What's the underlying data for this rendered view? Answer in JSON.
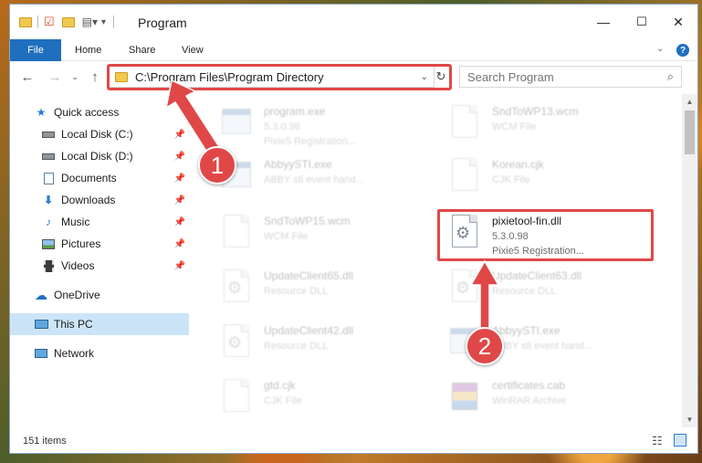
{
  "window": {
    "title": "Program",
    "controls": {
      "minimize": "—",
      "maximize": "☐",
      "close": "✕"
    }
  },
  "ribbon": {
    "tabs": [
      {
        "label": "File"
      },
      {
        "label": "Home"
      },
      {
        "label": "Share"
      },
      {
        "label": "View"
      }
    ],
    "help": "?"
  },
  "address_bar": {
    "path": "C:\\Program Files\\Program Directory",
    "search_placeholder": "Search Program"
  },
  "sidebar": {
    "items": [
      {
        "label": "Quick access",
        "icon": "star-icon"
      },
      {
        "label": "Local Disk (C:)",
        "icon": "drive-icon",
        "pinned": true
      },
      {
        "label": "Local Disk (D:)",
        "icon": "drive-icon",
        "pinned": true
      },
      {
        "label": "Documents",
        "icon": "documents-icon",
        "pinned": true
      },
      {
        "label": "Downloads",
        "icon": "download-icon",
        "pinned": true
      },
      {
        "label": "Music",
        "icon": "music-icon",
        "pinned": true
      },
      {
        "label": "Pictures",
        "icon": "pictures-icon",
        "pinned": true
      },
      {
        "label": "Videos",
        "icon": "videos-icon",
        "pinned": true
      },
      {
        "label": "OneDrive",
        "icon": "cloud-icon"
      },
      {
        "label": "This PC",
        "icon": "computer-icon",
        "selected": true
      },
      {
        "label": "Network",
        "icon": "network-icon"
      }
    ]
  },
  "files": [
    {
      "name": "program.exe",
      "line2": "5.3.0.98",
      "line3": "Pixie5 Registration...",
      "icon": "exe-icon"
    },
    {
      "name": "SndToWP13.wcm",
      "line2": "WCM File",
      "icon": "document-icon"
    },
    {
      "name": "AbbyySTI.exe",
      "line2": "ABBY sti event hand...",
      "icon": "exe-icon"
    },
    {
      "name": "Korean.cjk",
      "line2": "CJK File",
      "icon": "document-icon"
    },
    {
      "name": "SndToWP15.wcm",
      "line2": "WCM File",
      "icon": "document-icon"
    },
    {
      "name": "pixietool-fin.dll",
      "line2": "5.3.0.98",
      "line3": "Pixie5 Registration...",
      "icon": "dll-icon",
      "highlighted": true
    },
    {
      "name": "UpdateClient65.dll",
      "line2": "Resource DLL",
      "icon": "dll-icon"
    },
    {
      "name": "UpdateClient63.dll",
      "line2": "Resource DLL",
      "icon": "dll-icon"
    },
    {
      "name": "UpdateClient42.dll",
      "line2": "Resource DLL",
      "icon": "dll-icon"
    },
    {
      "name": "AbbyySTI.exe",
      "line2": "ABBY sti event hand...",
      "icon": "exe-icon"
    },
    {
      "name": "gtd.cjk",
      "line2": "CJK File",
      "icon": "document-icon"
    },
    {
      "name": "certificates.cab",
      "line2": "WinRAR Archive",
      "icon": "archive-icon"
    }
  ],
  "status_bar": {
    "item_count": "151 items"
  },
  "annotations": {
    "step1": "1",
    "step2": "2",
    "color": "#e04848"
  }
}
